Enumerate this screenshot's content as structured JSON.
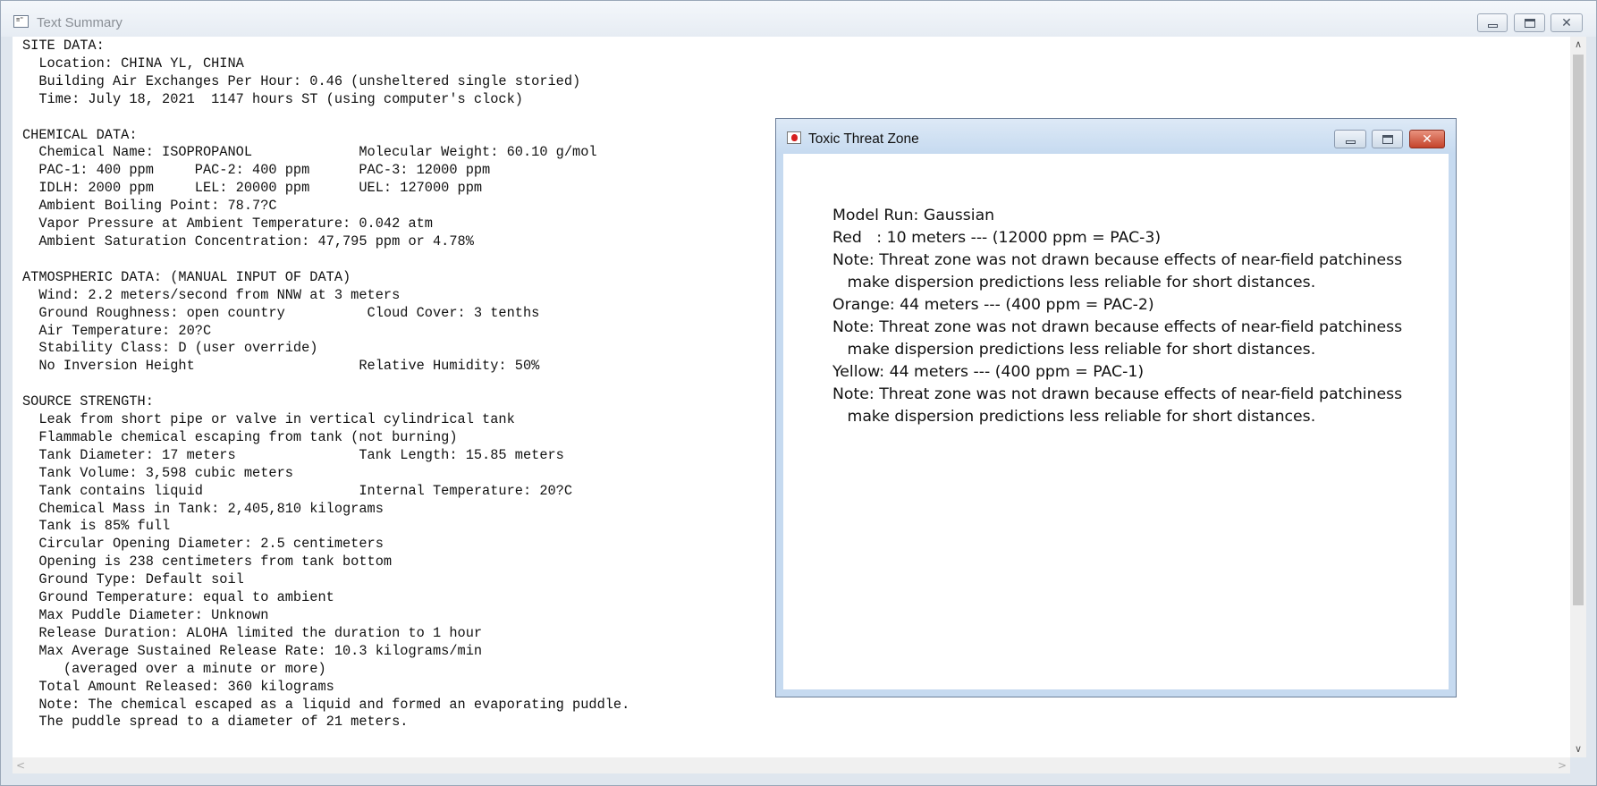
{
  "main_window": {
    "title": "Text Summary",
    "app_icon_glyph": "≡\"",
    "summary_lines": [
      "SITE DATA:",
      "  Location: CHINA YL, CHINA",
      "  Building Air Exchanges Per Hour: 0.46 (unsheltered single storied)",
      "  Time: July 18, 2021  1147 hours ST (using computer's clock)",
      "",
      "CHEMICAL DATA:",
      "  Chemical Name: ISOPROPANOL             Molecular Weight: 60.10 g/mol",
      "  PAC-1: 400 ppm     PAC-2: 400 ppm      PAC-3: 12000 ppm",
      "  IDLH: 2000 ppm     LEL: 20000 ppm      UEL: 127000 ppm",
      "  Ambient Boiling Point: 78.7?C",
      "  Vapor Pressure at Ambient Temperature: 0.042 atm",
      "  Ambient Saturation Concentration: 47,795 ppm or 4.78%",
      "",
      "ATMOSPHERIC DATA: (MANUAL INPUT OF DATA)",
      "  Wind: 2.2 meters/second from NNW at 3 meters",
      "  Ground Roughness: open country          Cloud Cover: 3 tenths",
      "  Air Temperature: 20?C",
      "  Stability Class: D (user override)",
      "  No Inversion Height                    Relative Humidity: 50%",
      "",
      "SOURCE STRENGTH:",
      "  Leak from short pipe or valve in vertical cylindrical tank",
      "  Flammable chemical escaping from tank (not burning)",
      "  Tank Diameter: 17 meters               Tank Length: 15.85 meters",
      "  Tank Volume: 3,598 cubic meters",
      "  Tank contains liquid                   Internal Temperature: 20?C",
      "  Chemical Mass in Tank: 2,405,810 kilograms",
      "  Tank is 85% full",
      "  Circular Opening Diameter: 2.5 centimeters",
      "  Opening is 238 centimeters from tank bottom",
      "  Ground Type: Default soil",
      "  Ground Temperature: equal to ambient",
      "  Max Puddle Diameter: Unknown",
      "  Release Duration: ALOHA limited the duration to 1 hour",
      "  Max Average Sustained Release Rate: 10.3 kilograms/min",
      "     (averaged over a minute or more)",
      "  Total Amount Released: 360 kilograms",
      "  Note: The chemical escaped as a liquid and formed an evaporating puddle.",
      "  The puddle spread to a diameter of 21 meters."
    ]
  },
  "threat_window": {
    "title": "Toxic Threat Zone",
    "icon": "alert-drop-icon",
    "lines": [
      "Model Run: Gaussian",
      "Red   : 10 meters --- (12000 ppm = PAC-3)",
      "Note: Threat zone was not drawn because effects of near-field patchiness",
      "   make dispersion predictions less reliable for short distances.",
      "Orange: 44 meters --- (400 ppm = PAC-2)",
      "Note: Threat zone was not drawn because effects of near-field patchiness",
      "   make dispersion predictions less reliable for short distances.",
      "Yellow: 44 meters --- (400 ppm = PAC-1)",
      "Note: Threat zone was not drawn because effects of near-field patchiness",
      "   make dispersion predictions less reliable for short distances."
    ]
  },
  "window_controls": {
    "minimize_icon": "minimize-icon",
    "maximize_icon": "maximize-icon",
    "close_icon": "close-icon",
    "close_glyph": "✕"
  },
  "scrollbars": {
    "up_glyph": "∧",
    "down_glyph": "∨",
    "left_glyph": "<",
    "right_glyph": ">"
  }
}
